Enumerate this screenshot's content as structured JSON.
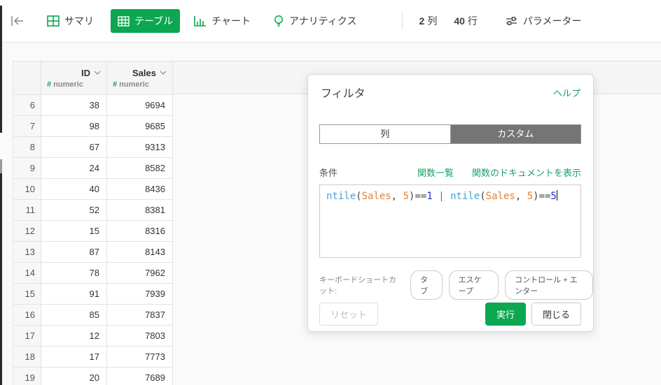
{
  "toolbar": {
    "tabs": [
      {
        "label": "サマリ"
      },
      {
        "label": "テーブル"
      },
      {
        "label": "チャート"
      },
      {
        "label": "アナリティクス"
      }
    ],
    "columns_count": "2",
    "columns_unit": "列",
    "rows_count": "40",
    "rows_unit": "行",
    "parameters_label": "パラメーター"
  },
  "table": {
    "columns": [
      {
        "name": "ID",
        "type_prefix": "#",
        "type_name": "numeric"
      },
      {
        "name": "Sales",
        "type_prefix": "#",
        "type_name": "numeric"
      }
    ],
    "rows": [
      [
        "6",
        "38",
        "9694"
      ],
      [
        "7",
        "98",
        "9685"
      ],
      [
        "8",
        "67",
        "9313"
      ],
      [
        "9",
        "24",
        "8582"
      ],
      [
        "10",
        "40",
        "8436"
      ],
      [
        "11",
        "52",
        "8381"
      ],
      [
        "12",
        "15",
        "8316"
      ],
      [
        "13",
        "87",
        "8143"
      ],
      [
        "14",
        "78",
        "7962"
      ],
      [
        "15",
        "91",
        "7939"
      ],
      [
        "16",
        "85",
        "7837"
      ],
      [
        "17",
        "12",
        "7803"
      ],
      [
        "18",
        "17",
        "7773"
      ],
      [
        "19",
        "20",
        "7689"
      ]
    ]
  },
  "dialog": {
    "title": "フィルタ",
    "help_label": "ヘルプ",
    "tabs": [
      {
        "label": "列",
        "active": false
      },
      {
        "label": "カスタム",
        "active": true
      }
    ],
    "condition_label": "条件",
    "function_list_label": "関数一覧",
    "function_doc_label": "関数のドキュメントを表示",
    "code_text": "ntile(Sales, 5)==1 | ntile(Sales, 5)==5",
    "code_tokens": [
      {
        "text": "ntile",
        "type": "func"
      },
      {
        "text": "(",
        "type": "plain"
      },
      {
        "text": "Sales",
        "type": "var"
      },
      {
        "text": ", ",
        "type": "plain"
      },
      {
        "text": "5",
        "type": "var"
      },
      {
        "text": ")",
        "type": "plain"
      },
      {
        "text": "==",
        "type": "plain"
      },
      {
        "text": "1",
        "type": "num"
      },
      {
        "text": " | ",
        "type": "pipe"
      },
      {
        "text": "ntile",
        "type": "func"
      },
      {
        "text": "(",
        "type": "plain"
      },
      {
        "text": "Sales",
        "type": "var"
      },
      {
        "text": ", ",
        "type": "plain"
      },
      {
        "text": "5",
        "type": "var"
      },
      {
        "text": ")",
        "type": "plain"
      },
      {
        "text": "==",
        "type": "plain"
      },
      {
        "text": "5",
        "type": "num"
      }
    ],
    "shortcut_label": "キーボードショートカット:",
    "shortcuts": [
      "タブ",
      "エスケープ",
      "コントロール + エンター"
    ],
    "reset_label": "リセット",
    "run_label": "実行",
    "close_label": "閉じる"
  },
  "colors": {
    "accent_green": "#0CA750",
    "link_green": "#18A268",
    "custom_tab_gray": "#757575",
    "code_function": "#4B9FD6",
    "code_argument": "#E0823C",
    "code_number": "#2631BE",
    "code_pipe": "#A9652E"
  }
}
